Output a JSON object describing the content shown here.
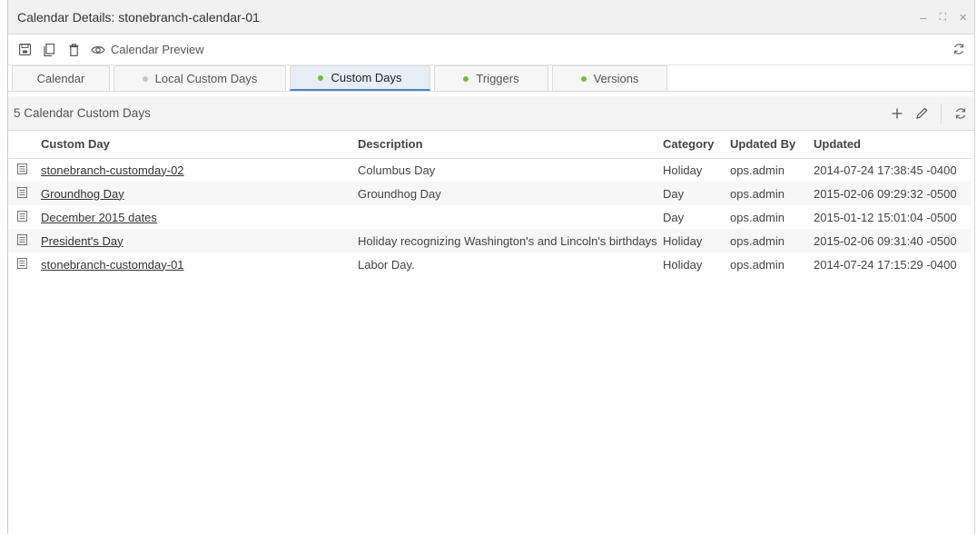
{
  "window": {
    "title": "Calendar Details: stonebranch-calendar-01",
    "controls": {
      "minimize": "–",
      "maximize": "⛶",
      "close": "×"
    }
  },
  "toolbar": {
    "preview_label": "Calendar Preview"
  },
  "tabs": [
    {
      "label": "Calendar",
      "dot": "none",
      "active": false
    },
    {
      "label": "Local Custom Days",
      "dot": "#c8c8c8",
      "active": false
    },
    {
      "label": "Custom Days",
      "dot": "#7cba3a",
      "active": true
    },
    {
      "label": "Triggers",
      "dot": "#7cba3a",
      "active": false
    },
    {
      "label": "Versions",
      "dot": "#7cba3a",
      "active": false
    }
  ],
  "panel": {
    "count_label": "5 Calendar Custom Days"
  },
  "table": {
    "headers": [
      "Custom Day",
      "Description",
      "Category",
      "Updated By",
      "Updated"
    ],
    "rows": [
      {
        "custom_day": "stonebranch-customday-02",
        "description": "Columbus Day",
        "category": "Holiday",
        "updated_by": "ops.admin",
        "updated": "2014-07-24 17:38:45 -0400"
      },
      {
        "custom_day": "Groundhog Day",
        "description": "Groundhog Day",
        "category": "Day",
        "updated_by": "ops.admin",
        "updated": "2015-02-06 09:29:32 -0500"
      },
      {
        "custom_day": "December 2015 dates",
        "description": "",
        "category": "Day",
        "updated_by": "ops.admin",
        "updated": "2015-01-12 15:01:04 -0500"
      },
      {
        "custom_day": "President's Day",
        "description": "Holiday recognizing Washington's and Lincoln's birthdays",
        "category": "Holiday",
        "updated_by": "ops.admin",
        "updated": "2015-02-06 09:31:40 -0500"
      },
      {
        "custom_day": "stonebranch-customday-01",
        "description": "Labor Day.",
        "category": "Holiday",
        "updated_by": "ops.admin",
        "updated": "2014-07-24 17:15:29 -0400"
      }
    ]
  },
  "colors": {
    "accent": "#4a86c5",
    "status_green": "#7cba3a",
    "status_gray": "#c8c8c8"
  }
}
